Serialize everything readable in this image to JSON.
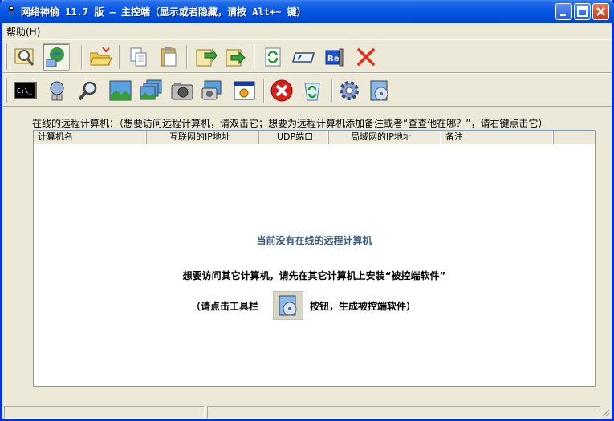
{
  "window": {
    "title": "网络神偷 11.7 版 — 主控端（显示或者隐藏，请按 Alt+~ 键）",
    "buttons": [
      "minimize",
      "maximize",
      "close"
    ]
  },
  "menu": {
    "help": "帮助(H)"
  },
  "toolbar_row1": [
    "search-computer-icon",
    "network-globe-icon",
    "open-folder-icon",
    "copy-icon",
    "paste-icon",
    "download-icon",
    "upload-icon",
    "refresh-icon",
    "rename-icon",
    "registry-icon",
    "delete-icon"
  ],
  "toolbar_row2": [
    "command-prompt-icon",
    "network-icon",
    "search-icon",
    "screenshot-icon",
    "multi-screenshot-icon",
    "camera-icon",
    "webcam-icon",
    "settings-window-icon",
    "stop-icon",
    "recycle-icon",
    "gear-icon",
    "install-disk-icon"
  ],
  "list": {
    "label": "在线的远程计算机：（想要访问远程计算机，请双击它；想要为远程计算机添加备注或者“查查他在哪？”，请右键点击它）",
    "columns": [
      "计算机名",
      "互联网的IP地址",
      "UDP端口",
      "局域网的IP地址",
      "备注"
    ],
    "empty_title": "当前没有在线的远程计算机",
    "empty_hint": "想要访问其它计算机，请先在其它计算机上安装“被控端软件”",
    "empty_hint2_pre": "（请点击工具栏",
    "empty_hint2_post": "按钮，生成被控端软件）"
  },
  "colors": {
    "titlebar": "#0a5ae6",
    "frame": "#0831d9",
    "face": "#ece9d8",
    "empty_title": "#3a5a7a"
  }
}
